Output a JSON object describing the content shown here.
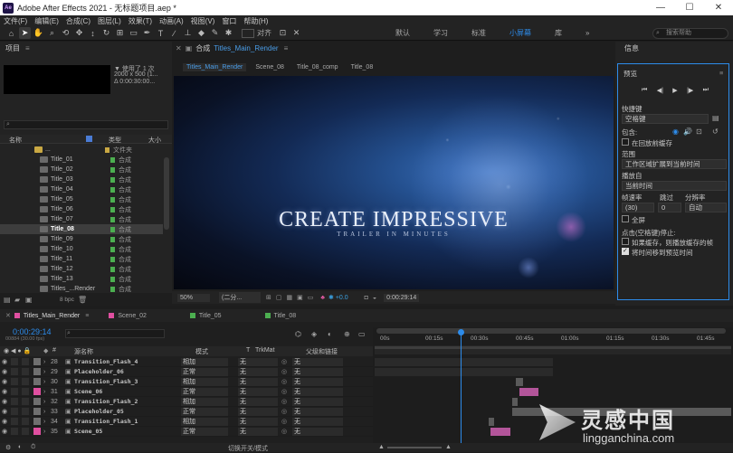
{
  "window": {
    "title": "Adobe After Effects 2021 - 无标题项目.aep *",
    "app_badge": "Ae",
    "minimize": "—",
    "maximize": "☐",
    "close": "✕"
  },
  "menu": [
    "文件(F)",
    "编辑(E)",
    "合成(C)",
    "图层(L)",
    "效果(T)",
    "动画(A)",
    "视图(V)",
    "窗口",
    "帮助(H)"
  ],
  "toolbar": {
    "align_label": "对齐",
    "workspaces": [
      "默认",
      "学习",
      "标准",
      "小屏幕",
      "库"
    ],
    "active_workspace": "小屏幕",
    "expand": "»",
    "search_placeholder": "搜索帮助"
  },
  "project": {
    "title": "项目",
    "menu": "≡",
    "info_line1": "▼ 使用了 1 次",
    "info_line2": "2000 x 500 (1...",
    "info_line3": "Δ 0:00:30:00...",
    "search_icon": "⌕",
    "col_name": "名称",
    "col_type": "类型",
    "col_size": "大小",
    "items": [
      {
        "name": "...",
        "type": "文件夹",
        "folder": true
      },
      {
        "name": "Title_01",
        "type": "合成"
      },
      {
        "name": "Title_02",
        "type": "合成"
      },
      {
        "name": "Title_03",
        "type": "合成"
      },
      {
        "name": "Title_04",
        "type": "合成"
      },
      {
        "name": "Title_05",
        "type": "合成"
      },
      {
        "name": "Title_06",
        "type": "合成"
      },
      {
        "name": "Title_07",
        "type": "合成"
      },
      {
        "name": "Title_08",
        "type": "合成",
        "selected": true
      },
      {
        "name": "Title_09",
        "type": "合成"
      },
      {
        "name": "Title_10",
        "type": "合成"
      },
      {
        "name": "Title_11",
        "type": "合成"
      },
      {
        "name": "Title_12",
        "type": "合成"
      },
      {
        "name": "Title_13",
        "type": "合成"
      },
      {
        "name": "Titles_...Render",
        "type": "合成"
      }
    ],
    "bpc": "8 bpc"
  },
  "comp": {
    "panel_title": "合成",
    "comp_name": "Titles_Main_Render",
    "menu": "≡",
    "tabs": [
      "Titles_Main_Render",
      "Scene_08",
      "Title_08_comp",
      "Title_08"
    ],
    "headline": "CREATE IMPRESSIVE",
    "subline": "TRAILER IN MINUTES",
    "zoom": "50%",
    "resolution": "(二分...",
    "exposure": "+0.0",
    "timecode": "0:00:29:14"
  },
  "info": {
    "title": "信息",
    "preview_title": "预览",
    "menu": "≡",
    "controls": [
      "⏮",
      "◀|",
      "▶",
      "|▶",
      "⏭"
    ],
    "shortcut_label": "快捷键",
    "shortcut_value": "空格键",
    "include_label": "包含:",
    "cache_before": "在回放前缓存",
    "range_label": "范围",
    "range_value": "工作区域扩展到当前时间",
    "play_from_label": "播放自",
    "play_from_value": "当前时间",
    "fps_label": "帧速率",
    "skip_label": "跳过",
    "res_label": "分辨率",
    "fps_value": "(30)",
    "skip_value": "0",
    "res_value": "自动",
    "fullscreen": "全屏",
    "stop_label": "点击(空格键)停止:",
    "if_cache": "如果缓存，则播放缓存的帧",
    "move_time": "将时间移到预览时间"
  },
  "timeline": {
    "tabs": [
      {
        "name": "Titles_Main_Render",
        "color": "#e04fa0"
      },
      {
        "name": "Scene_02",
        "color": "#e04fa0"
      },
      {
        "name": "Title_05",
        "color": "#4caf50"
      },
      {
        "name": "Title_08",
        "color": "#4caf50"
      }
    ],
    "timecode": "0:00:29:14",
    "timecode_sub": "00884 (30.00 fps)",
    "col_src": "源名称",
    "col_mode": "模式",
    "col_t": "T",
    "col_trk": "TrkMat",
    "col_parent": "父级和链接",
    "toggle_label": "切换开关/模式",
    "ruler": [
      "00s",
      "00:15s",
      "00:30s",
      "00:45s",
      "01:00s",
      "01:15s",
      "01:30s",
      "01:45s"
    ],
    "playhead_pct": 0.24,
    "layers": [
      {
        "num": "28",
        "name": "Transition_Flash_4",
        "mode": "相加",
        "trk": "无",
        "parent": "无",
        "color": "#7a7a7a",
        "start": 0.0,
        "end": 0.5
      },
      {
        "num": "29",
        "name": "Placeholder_06",
        "mode": "正常",
        "trk": "无",
        "parent": "无",
        "color": "#7a7a7a",
        "start": 0.0,
        "end": 0.5
      },
      {
        "num": "30",
        "name": "Transition_Flash_3",
        "mode": "相加",
        "trk": "无",
        "parent": "无",
        "color": "#7a7a7a",
        "start": 0.395,
        "end": 0.415
      },
      {
        "num": "31",
        "name": "Scene_06",
        "mode": "正常",
        "trk": "无",
        "parent": "无",
        "color": "#e04fa0",
        "start": 0.405,
        "end": 0.46
      },
      {
        "num": "32",
        "name": "Transition_Flash_2",
        "mode": "相加",
        "trk": "无",
        "parent": "无",
        "color": "#7a7a7a",
        "start": 0.385,
        "end": 0.4
      },
      {
        "num": "33",
        "name": "Placeholder_05",
        "mode": "正常",
        "trk": "无",
        "parent": "无",
        "color": "#7a7a7a",
        "start": 0.385,
        "end": 1.0
      },
      {
        "num": "34",
        "name": "Transition_Flash_1",
        "mode": "相加",
        "trk": "无",
        "parent": "无",
        "color": "#7a7a7a",
        "start": 0.32,
        "end": 0.335
      },
      {
        "num": "35",
        "name": "Scene_05",
        "mode": "正常",
        "trk": "无",
        "parent": "无",
        "color": "#e04fa0",
        "start": 0.325,
        "end": 0.38
      }
    ]
  },
  "watermark": {
    "brand_cn": "灵感中国",
    "brand_url": "lingganchina.com"
  }
}
